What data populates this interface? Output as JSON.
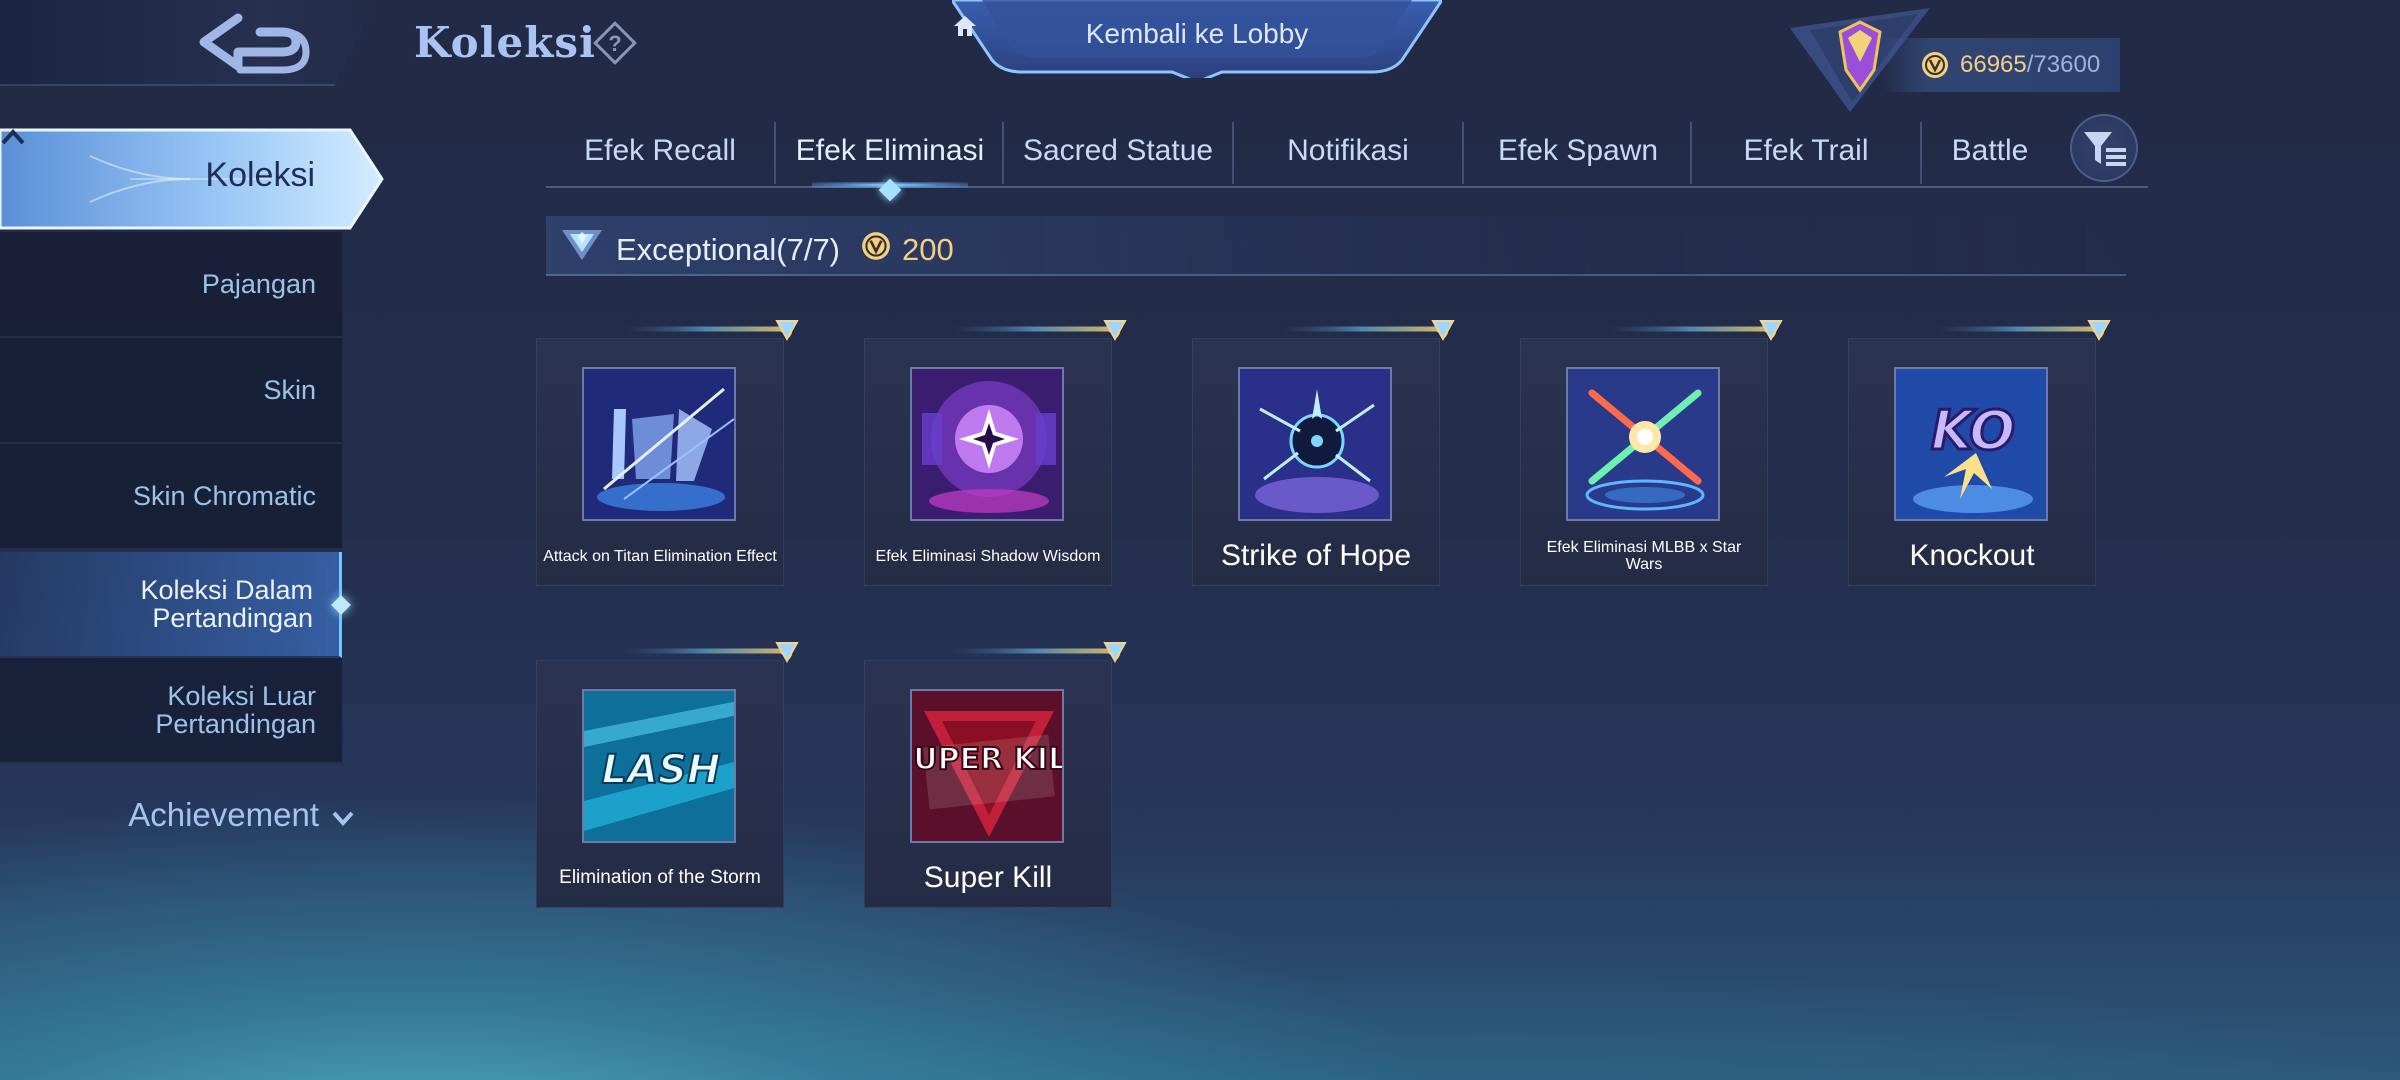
{
  "header": {
    "title": "Koleksi",
    "lobby_label": "Kembali ke Lobby",
    "currency": {
      "current": "66965",
      "separator": "/",
      "max": "73600"
    }
  },
  "sidebar": {
    "main": "Koleksi",
    "items": [
      {
        "label": "Pajangan"
      },
      {
        "label": "Skin"
      },
      {
        "label": "Skin Chromatic"
      },
      {
        "label": "Koleksi Dalam Pertandingan",
        "active": true
      },
      {
        "label": "Koleksi Luar Pertandingan"
      }
    ],
    "achievement": "Achievement"
  },
  "tabs": [
    {
      "label": "Efek Recall"
    },
    {
      "label": "Efek Eliminasi",
      "active": true
    },
    {
      "label": "Sacred Statue"
    },
    {
      "label": "Notifikasi"
    },
    {
      "label": "Efek Spawn"
    },
    {
      "label": "Efek Trail"
    },
    {
      "label": "Battle"
    }
  ],
  "section": {
    "title": "Exceptional(7/7)",
    "points": "200"
  },
  "items": [
    {
      "label": "Attack on Titan Elimination Effect"
    },
    {
      "label": "Efek Eliminasi Shadow Wisdom"
    },
    {
      "label": "Strike of Hope"
    },
    {
      "label": "Efek Eliminasi MLBB x Star Wars"
    },
    {
      "label": "Knockout",
      "art_text": "KO"
    },
    {
      "label": "Elimination of the Storm",
      "art_text": "LASH"
    },
    {
      "label": "Super Kill",
      "art_text": "SUPER KILL"
    }
  ],
  "colors": {
    "accent_gold": "#f2cf86",
    "accent_blue": "#74c8ff",
    "text_light": "#d8e6ff"
  }
}
